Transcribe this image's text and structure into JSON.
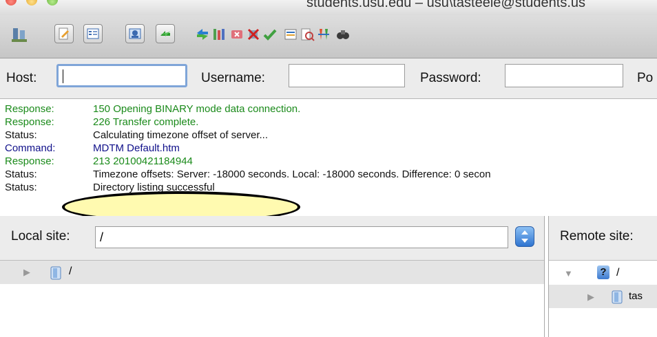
{
  "window": {
    "title": "students.usu.edu – usu\\tasteele@students.us"
  },
  "toolbar": {
    "icons": [
      "site-manager-icon",
      "message-log-icon",
      "local-tree-icon",
      "remote-tree-icon",
      "transfer-queue-icon",
      "refresh-icon",
      "process-queue-icon",
      "cancel-icon",
      "disconnect-icon",
      "reconnect-icon",
      "directory-listing-filters-icon",
      "directory-comparison-icon",
      "sync-browsing-icon",
      "search-icon"
    ]
  },
  "quickconnect": {
    "host_label": "Host:",
    "host_value": "",
    "username_label": "Username:",
    "username_value": "",
    "password_label": "Password:",
    "password_value": "",
    "port_label": "Po"
  },
  "log": [
    {
      "type": "Response:",
      "message": "150 Opening BINARY mode data connection.",
      "color": "#1a8a1a"
    },
    {
      "type": "Response:",
      "message": "226 Transfer complete.",
      "color": "#1a8a1a"
    },
    {
      "type": "Status:",
      "message": "Calculating timezone offset of server...",
      "color": "#111111"
    },
    {
      "type": "Command:",
      "message": "MDTM Default.htm",
      "color": "#10108a"
    },
    {
      "type": "Response:",
      "message": "213 20100421184944",
      "color": "#1a8a1a"
    },
    {
      "type": "Status:",
      "message": "Timezone offsets: Server: -18000 seconds. Local: -18000 seconds. Difference: 0 secon",
      "color": "#111111"
    },
    {
      "type": "Status:",
      "message": "Directory listing successful",
      "color": "#111111"
    }
  ],
  "local_site": {
    "label": "Local site:",
    "path": "/",
    "tree_root": "/"
  },
  "remote_site": {
    "label": "Remote site:",
    "tree_root": "/",
    "root_unknown_mark": "?",
    "child_folder": "tas"
  }
}
